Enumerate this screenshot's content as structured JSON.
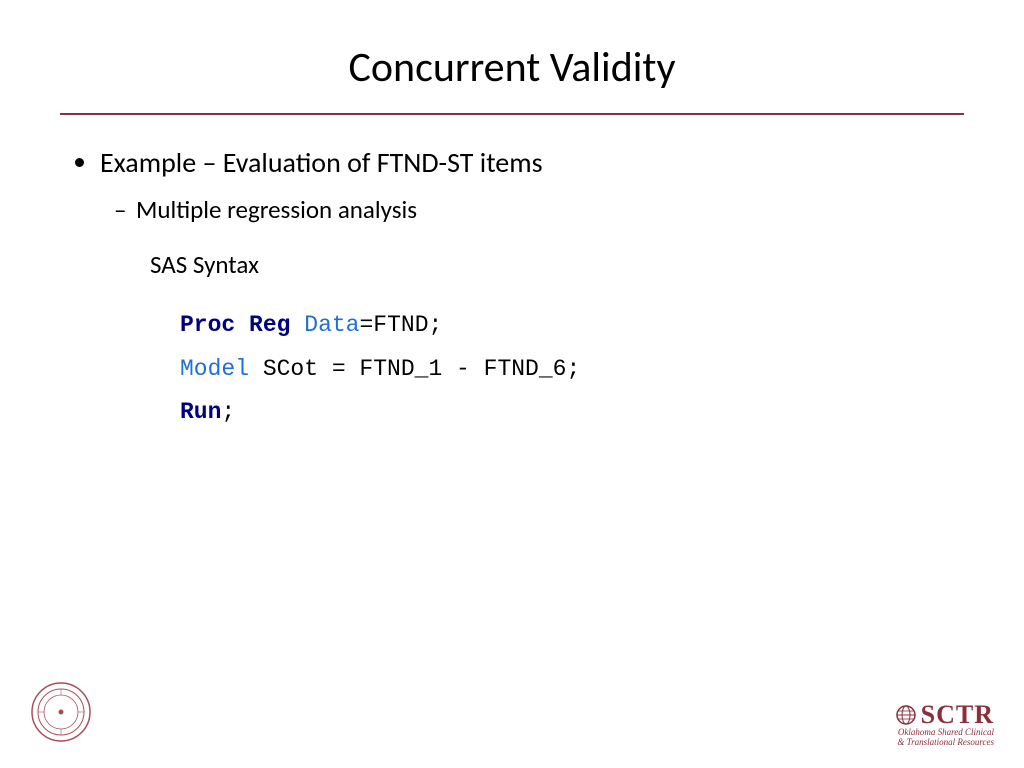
{
  "title": "Concurrent Validity",
  "bullets": {
    "l1": "Example – Evaluation of FTND-ST items",
    "l2": "Multiple regression analysis"
  },
  "syntax_label": "SAS Syntax",
  "code": {
    "line1": {
      "proc": "Proc",
      "reg": "Reg",
      "data": "Data",
      "rest": "=FTND;"
    },
    "line2": {
      "model": "Model",
      "rest": " SCot = FTND_1 - FTND_6;"
    },
    "line3": {
      "run": "Run",
      "semi": ";"
    }
  },
  "footer": {
    "logo_text": "SCTR",
    "logo_sub1": "Oklahoma Shared Clinical",
    "logo_sub2": "& Translational Resources"
  }
}
